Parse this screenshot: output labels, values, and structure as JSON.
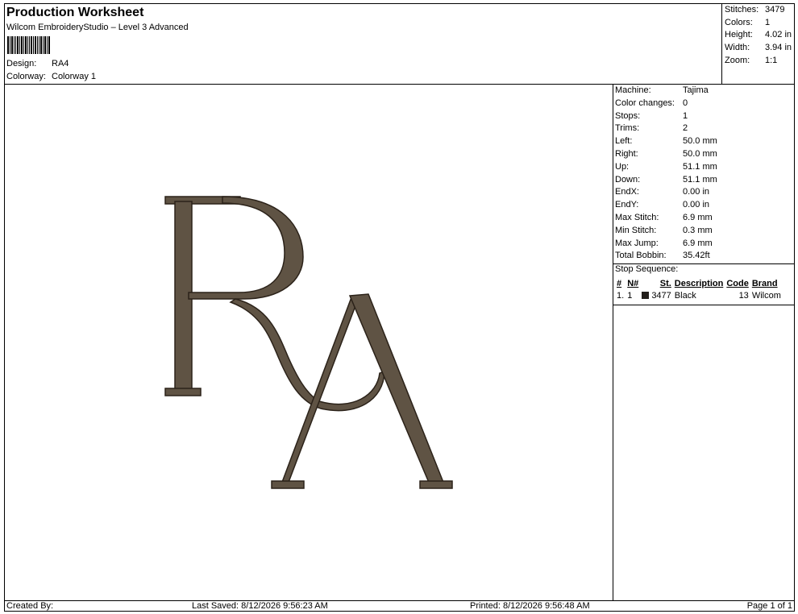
{
  "header": {
    "title": "Production Worksheet",
    "subtitle": "Wilcom EmbroideryStudio – Level 3 Advanced",
    "design_label": "Design:",
    "design_value": "RA4",
    "colorway_label": "Colorway:",
    "colorway_value": "Colorway 1"
  },
  "stats": [
    {
      "label": "Stitches:",
      "value": "3479"
    },
    {
      "label": "Colors:",
      "value": "1"
    },
    {
      "label": "Height:",
      "value": "4.02 in"
    },
    {
      "label": "Width:",
      "value": "3.94 in"
    },
    {
      "label": "Zoom:",
      "value": "1:1"
    }
  ],
  "details": [
    {
      "label": "Machine:",
      "value": "Tajima"
    },
    {
      "label": "Color changes:",
      "value": "0"
    },
    {
      "label": "Stops:",
      "value": "1"
    },
    {
      "label": "Trims:",
      "value": "2"
    },
    {
      "label": "Left:",
      "value": "50.0 mm"
    },
    {
      "label": "Right:",
      "value": "50.0 mm"
    },
    {
      "label": "Up:",
      "value": "51.1 mm"
    },
    {
      "label": "Down:",
      "value": "51.1 mm"
    },
    {
      "label": "EndX:",
      "value": "0.00 in"
    },
    {
      "label": "EndY:",
      "value": "0.00 in"
    },
    {
      "label": "Max Stitch:",
      "value": "6.9 mm"
    },
    {
      "label": "Min Stitch:",
      "value": "0.3 mm"
    },
    {
      "label": "Max Jump:",
      "value": "6.9 mm"
    },
    {
      "label": "Total Bobbin:",
      "value": "35.42ft"
    }
  ],
  "stop_sequence": {
    "title": "Stop Sequence:",
    "columns": [
      "#",
      "N#",
      "St.",
      "Description",
      "Code",
      "Brand"
    ],
    "rows": [
      {
        "idx": "1.",
        "n": "1",
        "color": "#231f1b",
        "st": "3477",
        "desc": "Black",
        "code": "13",
        "brand": "Wilcom"
      }
    ]
  },
  "design": {
    "monogram": "RA",
    "thread_color": "#5f5344",
    "outline_color": "#2b2219"
  },
  "footer": {
    "created": "Created By:",
    "saved": "Last Saved: 8/12/2026 9:56:23 AM",
    "printed": "Printed: 8/12/2026 9:56:48 AM",
    "page": "Page 1 of 1"
  }
}
